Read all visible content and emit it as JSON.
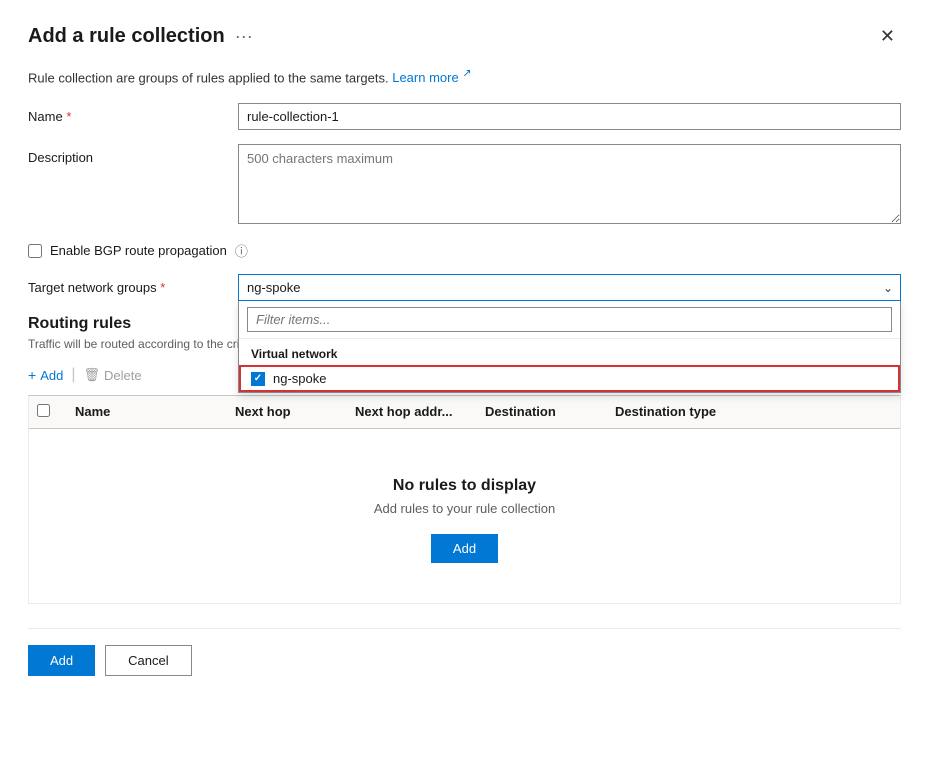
{
  "dialog": {
    "title": "Add a rule collection",
    "more_label": "···",
    "info_text": "Rule collection are groups of rules applied to the same targets.",
    "learn_more_label": "Learn more",
    "close_label": "✕"
  },
  "form": {
    "name_label": "Name",
    "name_required": true,
    "name_value": "rule-collection-1",
    "description_label": "Description",
    "description_placeholder": "500 characters maximum",
    "bgp_label": "Enable BGP route propagation",
    "bgp_info": "ⓘ",
    "target_network_label": "Target network groups",
    "target_network_required": true,
    "target_network_value": "ng-spoke",
    "dropdown_filter_placeholder": "Filter items...",
    "dropdown_section": "Virtual network",
    "dropdown_item": "ng-spoke",
    "dropdown_item_checked": true
  },
  "routing_rules": {
    "title": "Routing rules",
    "description": "Traffic will be routed according to the criteri",
    "add_label": "Add",
    "delete_label": "Delete"
  },
  "table": {
    "columns": [
      "Name",
      "Next hop",
      "Next hop addr...",
      "Destination",
      "Destination type"
    ],
    "empty_title": "No rules to display",
    "empty_sub": "Add rules to your rule collection",
    "add_label": "Add"
  },
  "footer": {
    "add_label": "Add",
    "cancel_label": "Cancel"
  }
}
